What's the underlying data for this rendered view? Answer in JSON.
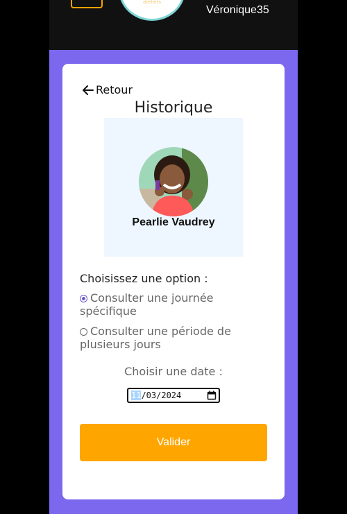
{
  "header": {
    "logo_text": "ateliers",
    "username": "Véronique35"
  },
  "card": {
    "back_label": "Retour",
    "title": "Historique",
    "child_name": "Pearlie Vaudrey"
  },
  "options": {
    "label": "Choisissez une option :",
    "items": [
      {
        "label": "Consulter une journée spécifique",
        "selected": true
      },
      {
        "label": "Consulter une période de plusieurs jours",
        "selected": false
      }
    ]
  },
  "date": {
    "label": "Choisir une date :",
    "day": "11",
    "rest": "/03/2024"
  },
  "actions": {
    "validate_label": "Valider"
  },
  "colors": {
    "app_bg": "#7b68ee",
    "accent": "#ffa500",
    "radio": "#6a5acd"
  }
}
